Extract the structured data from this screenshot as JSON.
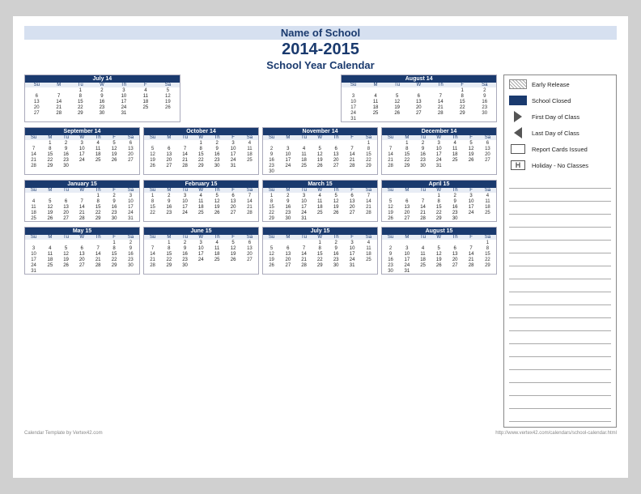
{
  "header": {
    "school_name": "Name of School",
    "year": "2014-2015",
    "subtitle": "School Year Calendar"
  },
  "legend": {
    "items": [
      {
        "id": "early-release",
        "label": "Early Release",
        "icon": "hatch"
      },
      {
        "id": "school-closed",
        "label": "School Closed",
        "icon": "solid-blue"
      },
      {
        "id": "first-day",
        "label": "First Day of Class",
        "icon": "arrow-right"
      },
      {
        "id": "last-day",
        "label": "Last Day of Class",
        "icon": "arrow-left"
      },
      {
        "id": "report-cards",
        "label": "Report Cards Issued",
        "icon": "report-box"
      },
      {
        "id": "holiday",
        "label": "Holiday - No Classes",
        "icon": "h-box"
      }
    ]
  },
  "footer": {
    "left": "Calendar Template by Vertex42.com",
    "right": "http://www.vertex42.com/calendars/school-calendar.html"
  },
  "months": [
    {
      "name": "July 14",
      "days_header": [
        "Su",
        "M",
        "Tu",
        "W",
        "Th",
        "F",
        "Sa"
      ],
      "weeks": [
        [
          "",
          "",
          "1",
          "2",
          "3",
          "4",
          "5"
        ],
        [
          "6",
          "7",
          "8",
          "9",
          "10",
          "11",
          "12"
        ],
        [
          "13",
          "14",
          "15",
          "16",
          "17",
          "18",
          "19"
        ],
        [
          "20",
          "21",
          "22",
          "23",
          "24",
          "25",
          "26"
        ],
        [
          "27",
          "28",
          "29",
          "30",
          "31",
          "",
          ""
        ]
      ]
    },
    {
      "name": "August 14",
      "days_header": [
        "Su",
        "M",
        "Tu",
        "W",
        "Th",
        "F",
        "Sa"
      ],
      "weeks": [
        [
          "",
          "",
          "",
          "",
          "",
          "1",
          "2"
        ],
        [
          "3",
          "4",
          "5",
          "6",
          "7",
          "8",
          "9"
        ],
        [
          "10",
          "11",
          "12",
          "13",
          "14",
          "15",
          "16"
        ],
        [
          "17",
          "18",
          "19",
          "20",
          "21",
          "22",
          "23"
        ],
        [
          "24",
          "25",
          "26",
          "27",
          "28",
          "29",
          "30"
        ],
        [
          "31",
          "",
          "",
          "",
          "",
          "",
          ""
        ]
      ]
    },
    {
      "name": "September 14",
      "days_header": [
        "Su",
        "M",
        "Tu",
        "W",
        "Th",
        "F",
        "Sa"
      ],
      "weeks": [
        [
          "",
          "1",
          "2",
          "3",
          "4",
          "5",
          "6"
        ],
        [
          "7",
          "8",
          "9",
          "10",
          "11",
          "12",
          "13"
        ],
        [
          "14",
          "15",
          "16",
          "17",
          "18",
          "19",
          "20"
        ],
        [
          "21",
          "22",
          "23",
          "24",
          "25",
          "26",
          "27"
        ],
        [
          "28",
          "29",
          "30",
          "",
          "",
          "",
          ""
        ]
      ]
    },
    {
      "name": "October 14",
      "days_header": [
        "Su",
        "M",
        "Tu",
        "W",
        "Th",
        "F",
        "Sa"
      ],
      "weeks": [
        [
          "",
          "",
          "",
          "1",
          "2",
          "3",
          "4"
        ],
        [
          "5",
          "6",
          "7",
          "8",
          "9",
          "10",
          "11"
        ],
        [
          "12",
          "13",
          "14",
          "15",
          "16",
          "17",
          "18"
        ],
        [
          "19",
          "20",
          "21",
          "22",
          "23",
          "24",
          "25"
        ],
        [
          "26",
          "27",
          "28",
          "29",
          "30",
          "31",
          ""
        ]
      ]
    },
    {
      "name": "November 14",
      "days_header": [
        "Su",
        "M",
        "Tu",
        "W",
        "Th",
        "F",
        "Sa"
      ],
      "weeks": [
        [
          "",
          "",
          "",
          "",
          "",
          "",
          "1"
        ],
        [
          "2",
          "3",
          "4",
          "5",
          "6",
          "7",
          "8"
        ],
        [
          "9",
          "10",
          "11",
          "12",
          "13",
          "14",
          "15"
        ],
        [
          "16",
          "17",
          "18",
          "19",
          "20",
          "21",
          "22"
        ],
        [
          "23",
          "24",
          "25",
          "26",
          "27",
          "28",
          "29"
        ],
        [
          "30",
          "",
          "",
          "",
          "",
          "",
          ""
        ]
      ]
    },
    {
      "name": "December 14",
      "days_header": [
        "Su",
        "M",
        "Tu",
        "W",
        "Th",
        "F",
        "Sa"
      ],
      "weeks": [
        [
          "",
          "1",
          "2",
          "3",
          "4",
          "5",
          "6"
        ],
        [
          "7",
          "8",
          "9",
          "10",
          "11",
          "12",
          "13"
        ],
        [
          "14",
          "15",
          "16",
          "17",
          "18",
          "19",
          "20"
        ],
        [
          "21",
          "22",
          "23",
          "24",
          "25",
          "26",
          "27"
        ],
        [
          "28",
          "29",
          "30",
          "31",
          "",
          "",
          ""
        ]
      ]
    },
    {
      "name": "January 15",
      "days_header": [
        "Su",
        "M",
        "Tu",
        "W",
        "Th",
        "F",
        "Sa"
      ],
      "weeks": [
        [
          "",
          "",
          "",
          "",
          "1",
          "2",
          "3"
        ],
        [
          "4",
          "5",
          "6",
          "7",
          "8",
          "9",
          "10"
        ],
        [
          "11",
          "12",
          "13",
          "14",
          "15",
          "16",
          "17"
        ],
        [
          "18",
          "19",
          "20",
          "21",
          "22",
          "23",
          "24"
        ],
        [
          "25",
          "26",
          "27",
          "28",
          "29",
          "30",
          "31"
        ]
      ]
    },
    {
      "name": "February 15",
      "days_header": [
        "Su",
        "M",
        "Tu",
        "W",
        "Th",
        "F",
        "Sa"
      ],
      "weeks": [
        [
          "1",
          "2",
          "3",
          "4",
          "5",
          "6",
          "7"
        ],
        [
          "8",
          "9",
          "10",
          "11",
          "12",
          "13",
          "14"
        ],
        [
          "15",
          "16",
          "17",
          "18",
          "19",
          "20",
          "21"
        ],
        [
          "22",
          "23",
          "24",
          "25",
          "26",
          "27",
          "28"
        ]
      ]
    },
    {
      "name": "March 15",
      "days_header": [
        "Su",
        "M",
        "Tu",
        "W",
        "Th",
        "F",
        "Sa"
      ],
      "weeks": [
        [
          "1",
          "2",
          "3",
          "4",
          "5",
          "6",
          "7"
        ],
        [
          "8",
          "9",
          "10",
          "11",
          "12",
          "13",
          "14"
        ],
        [
          "15",
          "16",
          "17",
          "18",
          "19",
          "20",
          "21"
        ],
        [
          "22",
          "23",
          "24",
          "25",
          "26",
          "27",
          "28"
        ],
        [
          "29",
          "30",
          "31",
          "",
          "",
          "",
          ""
        ]
      ]
    },
    {
      "name": "April 15",
      "days_header": [
        "Su",
        "M",
        "Tu",
        "W",
        "Th",
        "F",
        "Sa"
      ],
      "weeks": [
        [
          "",
          "",
          "",
          "1",
          "2",
          "3",
          "4"
        ],
        [
          "5",
          "6",
          "7",
          "8",
          "9",
          "10",
          "11"
        ],
        [
          "12",
          "13",
          "14",
          "15",
          "16",
          "17",
          "18"
        ],
        [
          "19",
          "20",
          "21",
          "22",
          "23",
          "24",
          "25"
        ],
        [
          "26",
          "27",
          "28",
          "29",
          "30",
          "",
          ""
        ]
      ]
    },
    {
      "name": "May 15",
      "days_header": [
        "Su",
        "M",
        "Tu",
        "W",
        "Th",
        "F",
        "Sa"
      ],
      "weeks": [
        [
          "",
          "",
          "",
          "",
          "",
          "1",
          "2"
        ],
        [
          "3",
          "4",
          "5",
          "6",
          "7",
          "8",
          "9"
        ],
        [
          "10",
          "11",
          "12",
          "13",
          "14",
          "15",
          "16"
        ],
        [
          "17",
          "18",
          "19",
          "20",
          "21",
          "22",
          "23"
        ],
        [
          "24",
          "25",
          "26",
          "27",
          "28",
          "29",
          "30"
        ],
        [
          "31",
          "",
          "",
          "",
          "",
          "",
          ""
        ]
      ]
    },
    {
      "name": "June 15",
      "days_header": [
        "Su",
        "M",
        "Tu",
        "W",
        "Th",
        "F",
        "Sa"
      ],
      "weeks": [
        [
          "",
          "1",
          "2",
          "3",
          "4",
          "5",
          "6"
        ],
        [
          "7",
          "8",
          "9",
          "10",
          "11",
          "12",
          "13"
        ],
        [
          "14",
          "15",
          "16",
          "17",
          "18",
          "19",
          "20"
        ],
        [
          "21",
          "22",
          "23",
          "24",
          "25",
          "26",
          "27"
        ],
        [
          "28",
          "29",
          "30",
          "",
          "",
          "",
          ""
        ]
      ]
    },
    {
      "name": "July 15",
      "days_header": [
        "Su",
        "M",
        "Tu",
        "W",
        "Th",
        "F",
        "Sa"
      ],
      "weeks": [
        [
          "",
          "",
          "",
          "1",
          "2",
          "3",
          "4"
        ],
        [
          "5",
          "6",
          "7",
          "8",
          "9",
          "10",
          "11"
        ],
        [
          "12",
          "13",
          "14",
          "15",
          "16",
          "17",
          "18"
        ],
        [
          "19",
          "20",
          "21",
          "22",
          "23",
          "24",
          "25"
        ],
        [
          "26",
          "27",
          "28",
          "29",
          "30",
          "31",
          ""
        ]
      ]
    },
    {
      "name": "August 15",
      "days_header": [
        "Su",
        "M",
        "Tu",
        "W",
        "Th",
        "F",
        "Sa"
      ],
      "weeks": [
        [
          "",
          "",
          "",
          "",
          "",
          "",
          "1"
        ],
        [
          "2",
          "3",
          "4",
          "5",
          "6",
          "7",
          "8"
        ],
        [
          "9",
          "10",
          "11",
          "12",
          "13",
          "14",
          "15"
        ],
        [
          "16",
          "17",
          "18",
          "19",
          "20",
          "21",
          "22"
        ],
        [
          "23",
          "24",
          "25",
          "26",
          "27",
          "28",
          "29"
        ],
        [
          "30",
          "31",
          "",
          "",
          "",
          "",
          ""
        ]
      ]
    }
  ]
}
